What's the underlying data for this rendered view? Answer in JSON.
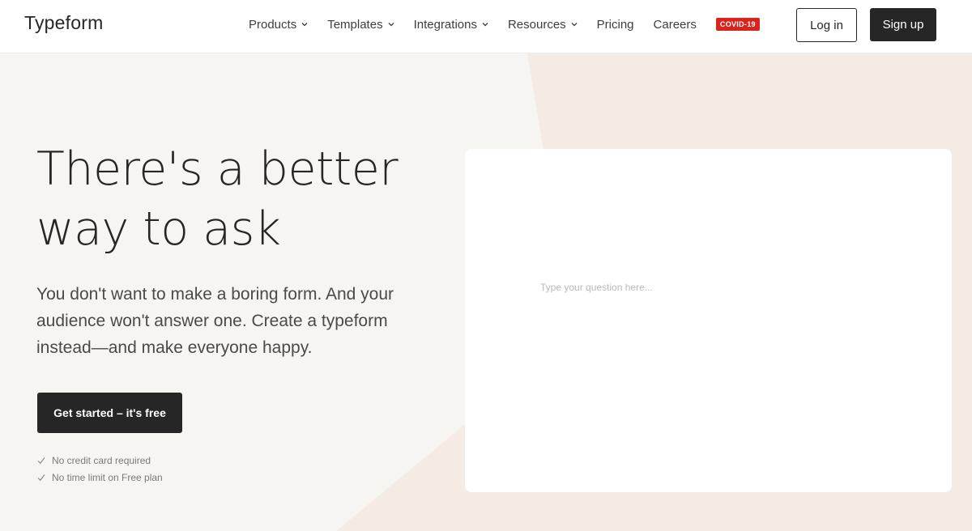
{
  "header": {
    "logo": "Typeform",
    "nav": [
      {
        "label": "Products",
        "dropdown": true
      },
      {
        "label": "Templates",
        "dropdown": true
      },
      {
        "label": "Integrations",
        "dropdown": true
      },
      {
        "label": "Resources",
        "dropdown": true
      },
      {
        "label": "Pricing",
        "dropdown": false
      },
      {
        "label": "Careers",
        "dropdown": false
      }
    ],
    "badge": "COVID-19",
    "login_label": "Log in",
    "signup_label": "Sign up"
  },
  "hero": {
    "title_line1": "There's a better",
    "title_line2": "way to ask",
    "subtitle": "You don't want to make a boring form. And your audience won't answer one. Create a typeform instead—and make everyone happy.",
    "cta_label": "Get started – it's free",
    "checks": [
      "No credit card required",
      "No time limit on Free plan"
    ]
  },
  "preview": {
    "placeholder": "Type your question here..."
  },
  "colors": {
    "background": "#f7f5f1",
    "shape": "#f3ebe4",
    "dark": "#262627",
    "badge": "#d9231c",
    "card": "#ffffff"
  }
}
